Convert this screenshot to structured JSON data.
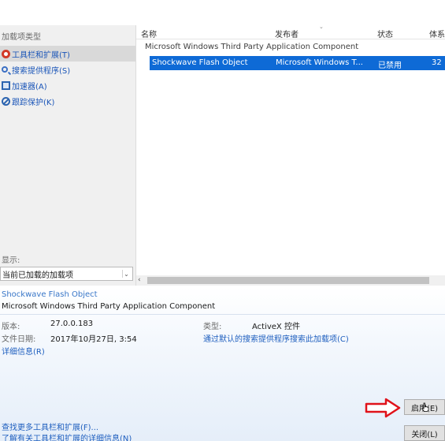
{
  "sidebar": {
    "title": "加载项类型",
    "items": [
      {
        "label": "工具栏和扩展(T)",
        "icon": "gear-icon",
        "active": true
      },
      {
        "label": "搜索提供程序(S)",
        "icon": "search-icon",
        "active": false
      },
      {
        "label": "加速器(A)",
        "icon": "accelerator-icon",
        "active": false
      },
      {
        "label": "跟踪保护(K)",
        "icon": "block-icon",
        "active": false
      }
    ],
    "show_label": "显示:",
    "show_selected": "当前已加载的加载项"
  },
  "table": {
    "columns": [
      "名称",
      "发布者",
      "状态",
      "体系"
    ],
    "group": "Microsoft Windows Third Party Application Component",
    "rows": [
      {
        "name": "Shockwave Flash Object",
        "publisher": "Microsoft Windows T...",
        "status": "已禁用",
        "arch": "32"
      }
    ]
  },
  "details": {
    "name": "Shockwave Flash Object",
    "publisher": "Microsoft Windows Third Party Application Component",
    "version_label": "版本:",
    "version": "27.0.0.183",
    "date_label": "文件日期:",
    "date": "2017年10月27日, 3:54",
    "more_info": "详细信息(R)",
    "type_label": "类型:",
    "type": "ActiveX 控件",
    "search_link": "通过默认的搜索提供程序搜索此加载项(C)",
    "find_more": "查找更多工具栏和扩展(F)...",
    "learn_more": "了解有关工具栏和扩展的详细信息(N)"
  },
  "buttons": {
    "enable": "启用(E)",
    "close": "关闭(L)"
  },
  "colors": {
    "selection": "#0e6ad6",
    "link": "#1f5fbf",
    "annotation_arrow": "#e0121a"
  }
}
